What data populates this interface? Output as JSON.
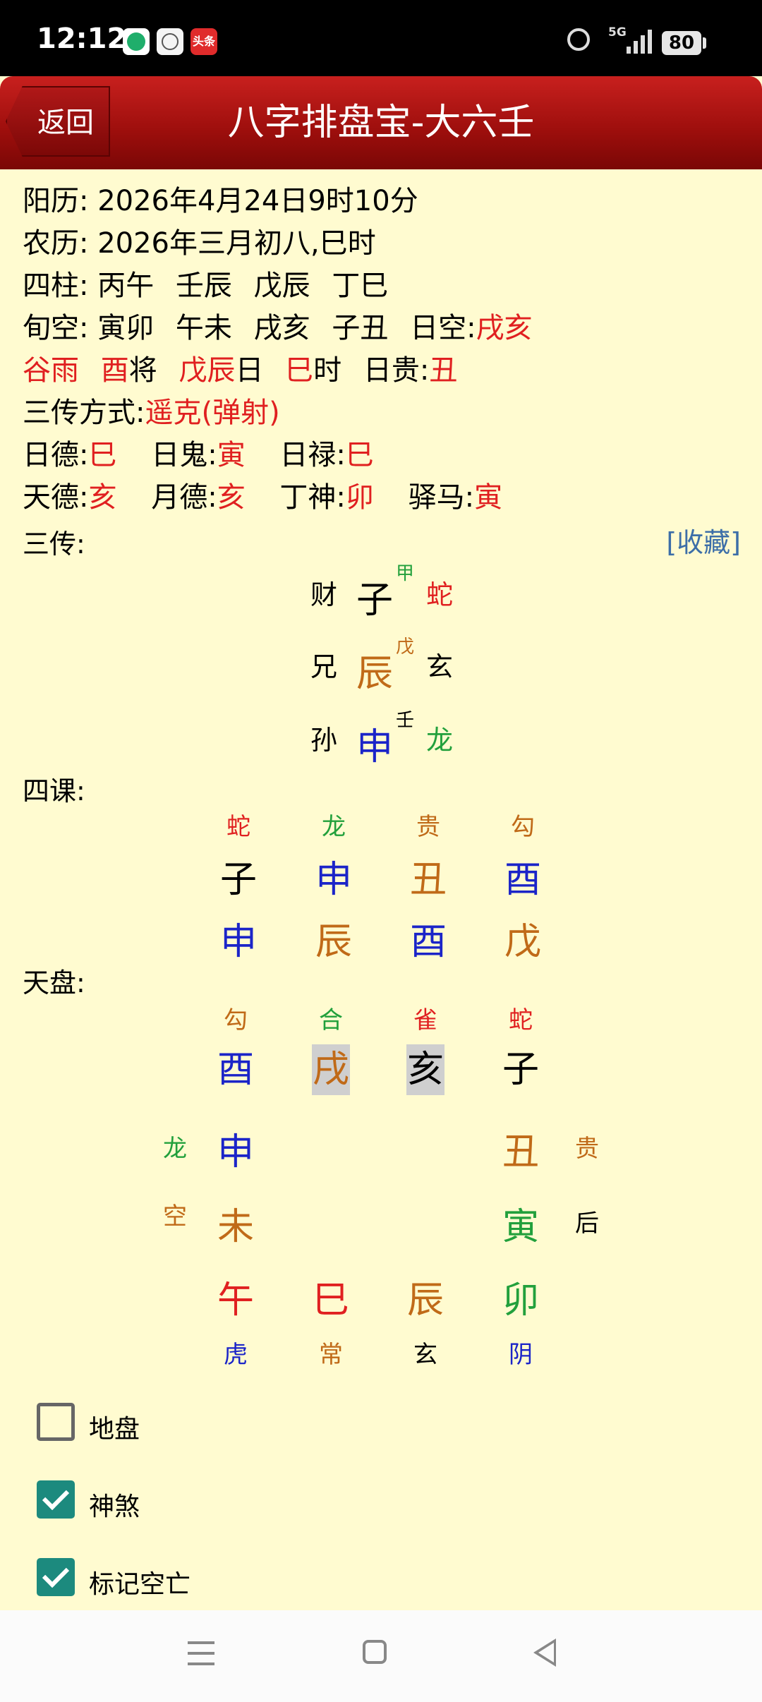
{
  "status_bar": {
    "time": "12:12",
    "app3_label": "头条",
    "network": "5G",
    "battery": "80"
  },
  "header": {
    "back_label": "返回",
    "title": "八字排盘宝-大六壬"
  },
  "info": {
    "solar_label": "阳历:",
    "solar_value": "2026年4月24日9时10分",
    "lunar_label": "农历:",
    "lunar_value": "2026年三月初八,巳时",
    "pillars_label": "四柱:",
    "pillars": [
      "丙午",
      "壬辰",
      "戊辰",
      "丁巳"
    ],
    "xunkong_label": "旬空:",
    "xunkong": [
      "寅卯",
      "午未",
      "戌亥",
      "子丑"
    ],
    "rikong_label": "日空:",
    "rikong_value": "戌亥",
    "solar_term": "谷雨",
    "general_branch": "酉",
    "general_suffix": "将",
    "day_stem": "戊辰",
    "day_suffix": "日",
    "hour_branch": "巳",
    "hour_suffix": "时",
    "rigui_label": "日贵:",
    "rigui_value": "丑",
    "method_label": "三传方式:",
    "method_value": "遥克(弹射)",
    "ride_label": "日德:",
    "ride_value": "巳",
    "rigui2_label": "日鬼:",
    "rigui2_value": "寅",
    "rilu_label": "日禄:",
    "rilu_value": "巳",
    "tiande_label": "天德:",
    "tiande_value": "亥",
    "yuede_label": "月德:",
    "yuede_value": "亥",
    "dingshen_label": "丁神:",
    "dingshen_value": "卯",
    "yima_label": "驿马:",
    "yima_value": "寅"
  },
  "sanchuan": {
    "label": "三传:",
    "favorite_label": "[收藏]",
    "rows": [
      {
        "relation": "财",
        "branch": "子",
        "stem": "甲",
        "god": "蛇"
      },
      {
        "relation": "兄",
        "branch": "辰",
        "stem": "戊",
        "god": "玄"
      },
      {
        "relation": "孙",
        "branch": "申",
        "stem": "壬",
        "god": "龙"
      }
    ]
  },
  "sike": {
    "label": "四课:",
    "gods": [
      "蛇",
      "龙",
      "贵",
      "勾"
    ],
    "upper": [
      "子",
      "申",
      "丑",
      "酉"
    ],
    "lower": [
      "申",
      "辰",
      "酉",
      "戊"
    ]
  },
  "tianpan": {
    "label": "天盘:",
    "top_gods": [
      "勾",
      "合",
      "雀",
      "蛇"
    ],
    "top_branches": [
      "酉",
      "戌",
      "亥",
      "子"
    ],
    "left_gods": [
      "龙",
      "空"
    ],
    "left_branches": [
      "申",
      "未"
    ],
    "right_branches": [
      "丑",
      "寅"
    ],
    "right_gods": [
      "贵",
      "后"
    ],
    "bottom_branches": [
      "午",
      "巳",
      "辰",
      "卯"
    ],
    "bottom_gods": [
      "虎",
      "常",
      "玄",
      "阴"
    ]
  },
  "options": [
    {
      "label": "地盘",
      "checked": false
    },
    {
      "label": "神煞",
      "checked": true
    },
    {
      "label": "标记空亡",
      "checked": true
    }
  ]
}
